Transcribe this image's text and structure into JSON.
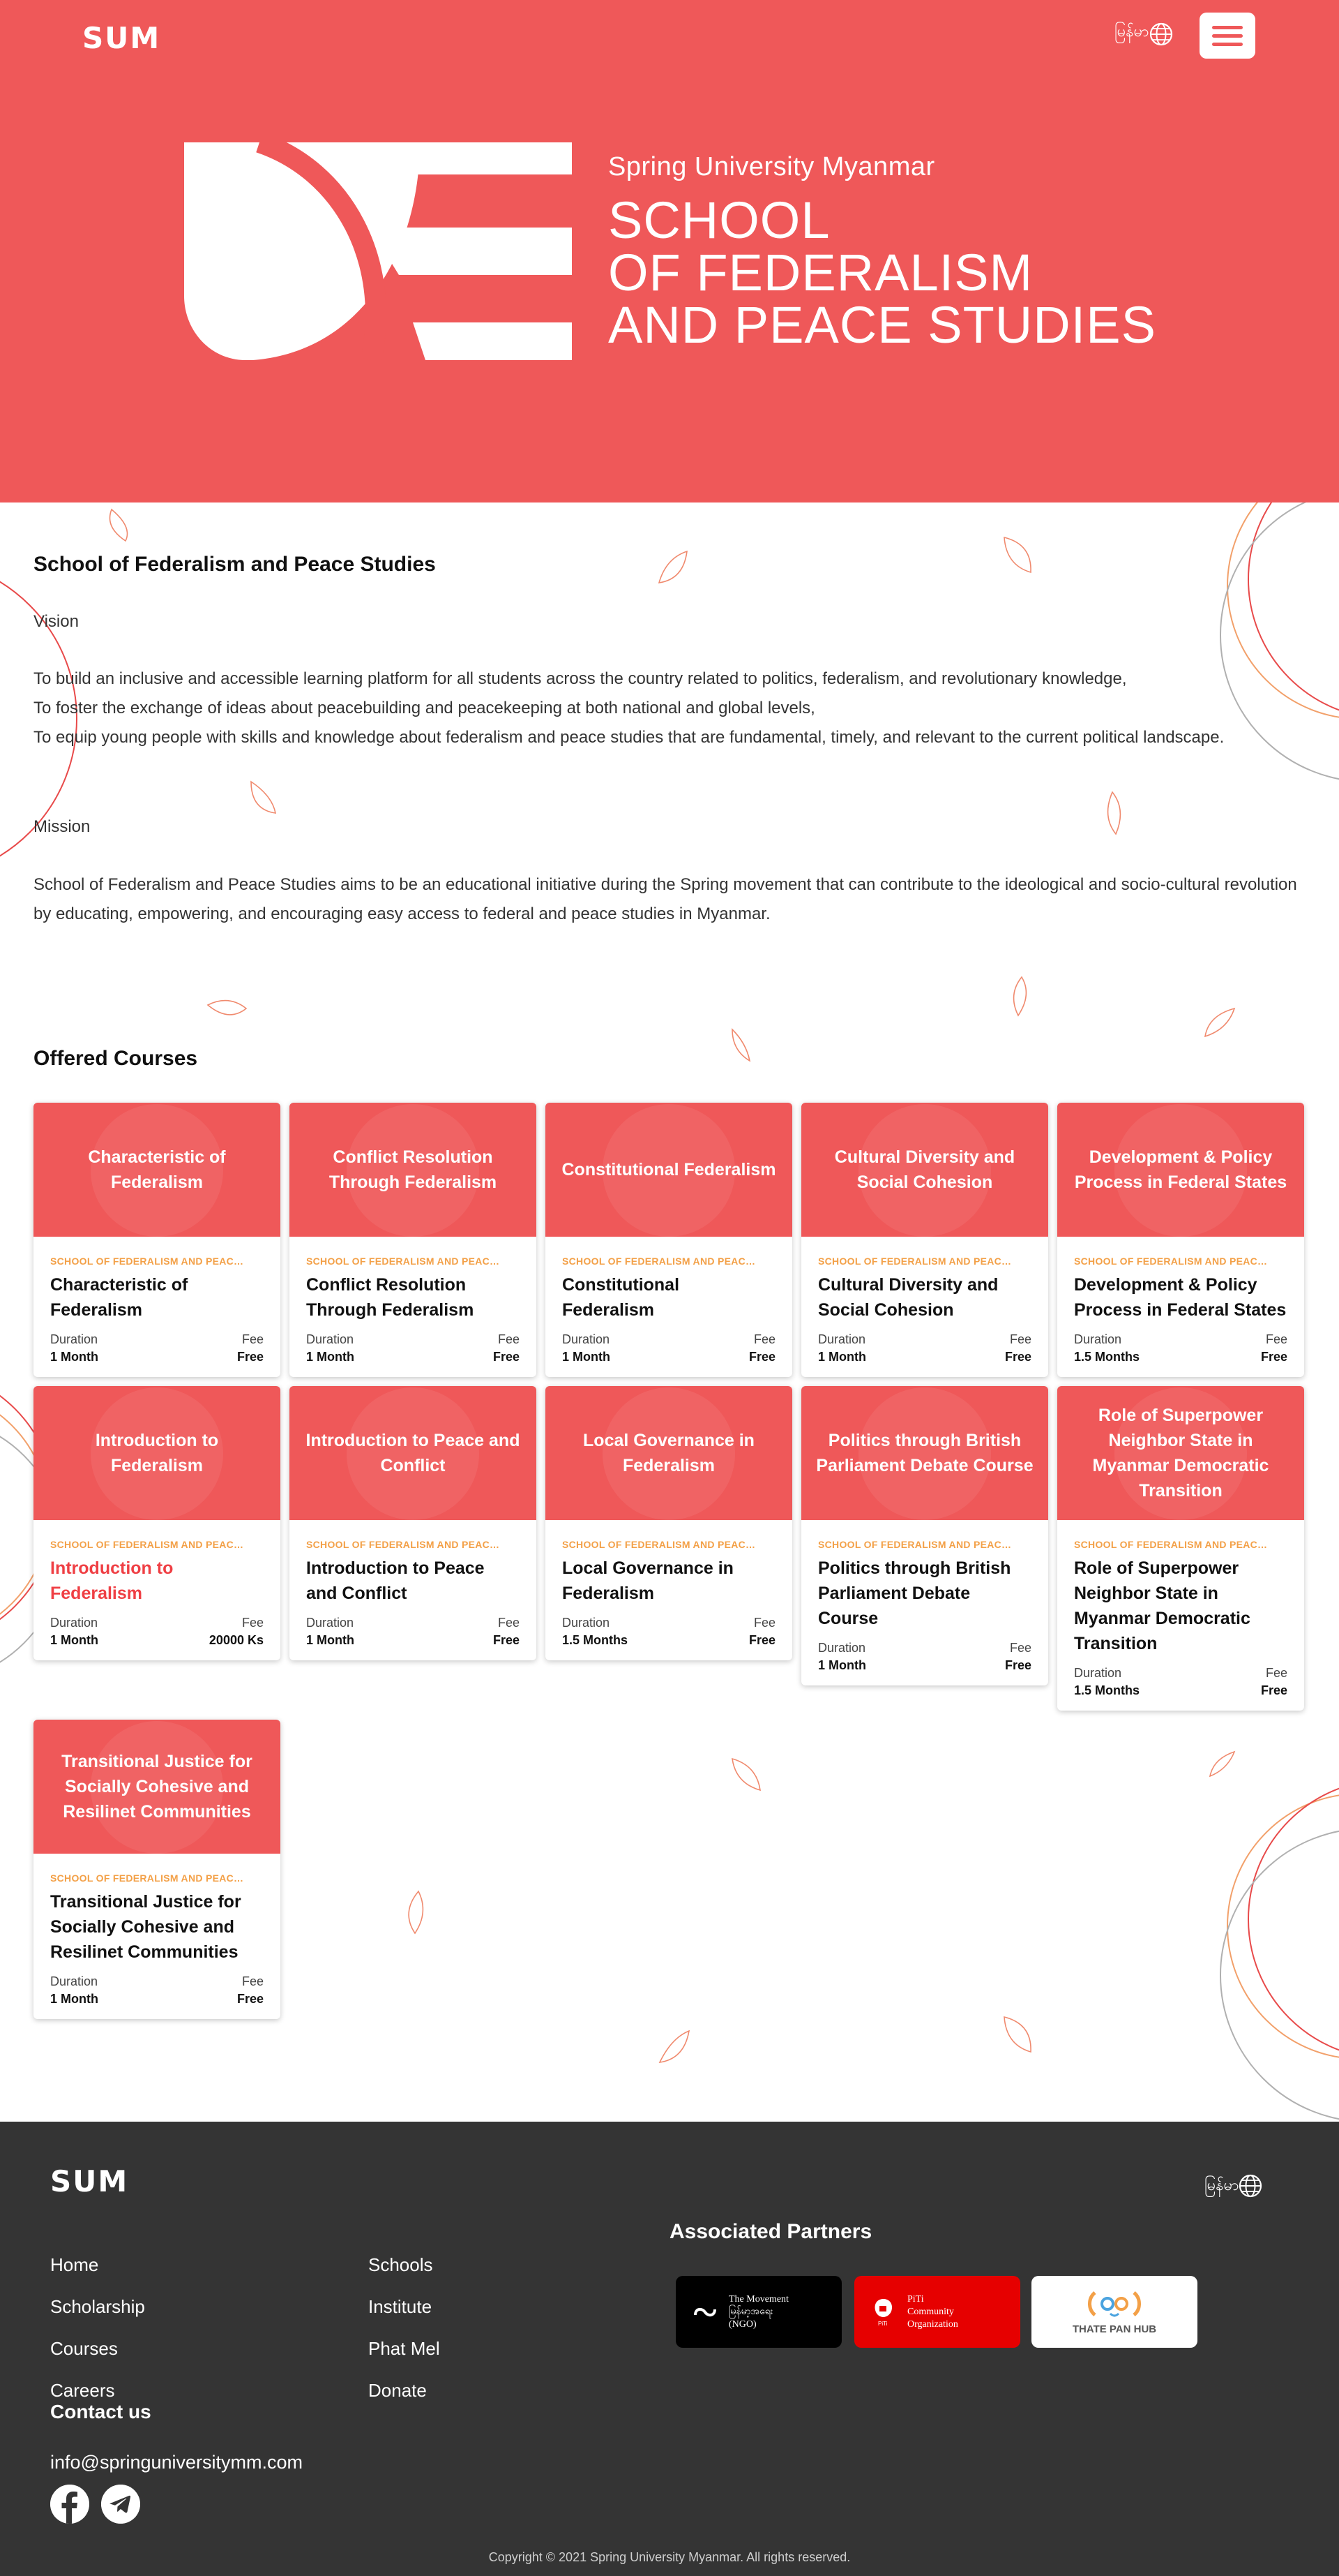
{
  "nav": {
    "logo": "SUM",
    "language": "မြန်မာ",
    "globe_icon": "globe-icon",
    "menu_icon": "hamburger-menu-icon"
  },
  "hero": {
    "university": "Spring University Myanmar",
    "title_lines": [
      "SCHOOL",
      "OF FEDERALISM",
      "AND PEACE STUDIES"
    ]
  },
  "about": {
    "title": "School of Federalism and Peace Studies",
    "vision_label": "Vision",
    "vision_lines": [
      "To build an inclusive and accessible learning platform for all students across the country related to politics, federalism, and revolutionary knowledge,",
      "To foster the exchange of ideas about peacebuilding and peacekeeping at both national and global levels,",
      "To equip young people with skills and knowledge about federalism and peace studies that are fundamental, timely, and relevant to the current political landscape."
    ],
    "mission_label": "Mission",
    "mission_text": "School of Federalism and Peace Studies aims to be an educational initiative during the Spring movement that can contribute to the ideological and socio-cultural revolution by educating, empowering, and encouraging easy access to federal and peace studies in Myanmar."
  },
  "courses": {
    "title": "Offered Courses",
    "school_label": "SCHOOL OF FEDERALISM AND PEACE STUDIES",
    "duration_label": "Duration",
    "fee_label": "Fee",
    "items": [
      {
        "banner": "Characteristic of Federalism",
        "title": "Characteristic of Federalism",
        "duration": "1 Month",
        "fee": "Free"
      },
      {
        "banner": "Conflict Resolution Through Federalism",
        "title": "Conflict Resolution Through Federalism",
        "duration": "1 Month",
        "fee": "Free"
      },
      {
        "banner": "Constitutional Federalism",
        "title": "Constitutional Federalism",
        "duration": "1 Month",
        "fee": "Free"
      },
      {
        "banner": "Cultural Diversity and Social Cohesion",
        "title": "Cultural Diversity and Social Cohesion",
        "duration": "1 Month",
        "fee": "Free"
      },
      {
        "banner": "Development & Policy Process in Federal States",
        "title": "Development & Policy Process in Federal States",
        "duration": "1.5 Months",
        "fee": "Free"
      },
      {
        "banner": "Introduction to Federalism",
        "title": "Introduction to Federalism",
        "duration": "1 Month",
        "fee": "20000 Ks",
        "highlighted": true
      },
      {
        "banner": "Introduction to Peace and Conflict",
        "title": "Introduction to Peace and Conflict",
        "duration": "1 Month",
        "fee": "Free"
      },
      {
        "banner": "Local Governance in Federalism",
        "title": "Local Governance in Federalism",
        "duration": "1.5 Months",
        "fee": "Free"
      },
      {
        "banner": "Politics through British Parliament Debate Course",
        "title": "Politics through British Parliament Debate Course",
        "duration": "1 Month",
        "fee": "Free"
      },
      {
        "banner": "Role of Superpower Neighbor State in Myanmar Democratic Transition",
        "title": "Role of Superpower Neighbor State in Myanmar Democratic Transition",
        "duration": "1.5 Months",
        "fee": "Free"
      },
      {
        "banner": "Transitional Justice for Socially Cohesive and Resilinet Communities",
        "title": "Transitional Justice for Socially Cohesive and Resilinet Communities",
        "duration": "1 Month",
        "fee": "Free"
      }
    ]
  },
  "footer": {
    "logo": "SUM",
    "language": "မြန်မာ",
    "links_col1": [
      "Home",
      "Scholarship",
      "Courses",
      "Careers"
    ],
    "links_col2": [
      "Schools",
      "Institute",
      "Phat Mel",
      "Donate"
    ],
    "contact_title": "Contact us",
    "email": "info@springuniversitymm.com",
    "social_icons": [
      "facebook-icon",
      "telegram-icon"
    ],
    "partners_title": "Associated Partners",
    "partners": [
      {
        "name_lines": [
          "The Movement",
          "မြန်မာ့အရေး",
          "(NGO)"
        ],
        "bg": "#000000"
      },
      {
        "name_lines": [
          "PiTi",
          "Community",
          "Organization"
        ],
        "bg": "#e60000"
      },
      {
        "name_lines": [
          "THATE PAN HUB"
        ],
        "bg": "#ffffff"
      }
    ],
    "copyright": "Copyright © 2021 Spring University Myanmar. All rights reserved."
  },
  "colors": {
    "brand": "#ef5859",
    "accent": "#f3a047",
    "footer": "#343434"
  }
}
